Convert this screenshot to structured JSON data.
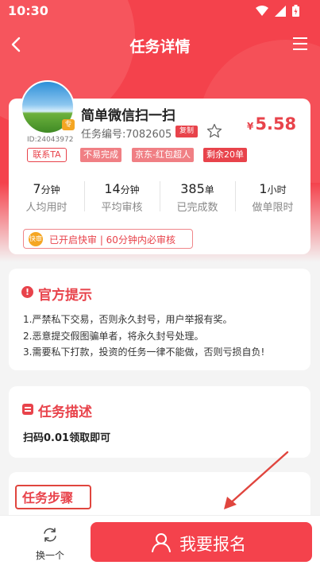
{
  "status_bar": {
    "time": "10:30"
  },
  "nav": {
    "title": "任务详情"
  },
  "task": {
    "user_id": "ID:24043972",
    "contact_label": "联系TA",
    "avatar_badge": "专",
    "title": "简单微信扫一扫",
    "task_no": "任务编号:7082605",
    "copy_label": "复制",
    "price_currency": "¥",
    "price": "5.58",
    "tags": [
      "不易完成",
      "京东-红包超人",
      "剩余20单"
    ]
  },
  "stats": [
    {
      "value": "7",
      "unit": "分钟",
      "label": "人均用时"
    },
    {
      "value": "14",
      "unit": "分钟",
      "label": "平均审核"
    },
    {
      "value": "385",
      "unit": "单",
      "label": "已完成数"
    },
    {
      "value": "1",
      "unit": "小时",
      "label": "做单限时"
    }
  ],
  "fast_review": {
    "icon_text": "快审",
    "text": "已开启快审 | 60分钟内必审核"
  },
  "notice": {
    "title": "官方提示",
    "lines": [
      "1.严禁私下交易，否则永久封号，用户举报有奖。",
      "2.恶意提交假图骗单者，将永久封号处理。",
      "3.需要私下打款，投资的任务一律不能做，否则亏损自负!"
    ]
  },
  "description": {
    "title": "任务描述",
    "text": "扫码0.01领取即可"
  },
  "steps": {
    "title": "任务步骤"
  },
  "bottom": {
    "swap_label": "换一个",
    "signup_label": "我要报名"
  },
  "colors": {
    "primary": "#f4424c",
    "accent_text": "#e8434b",
    "badge_orange": "#f5a623"
  }
}
